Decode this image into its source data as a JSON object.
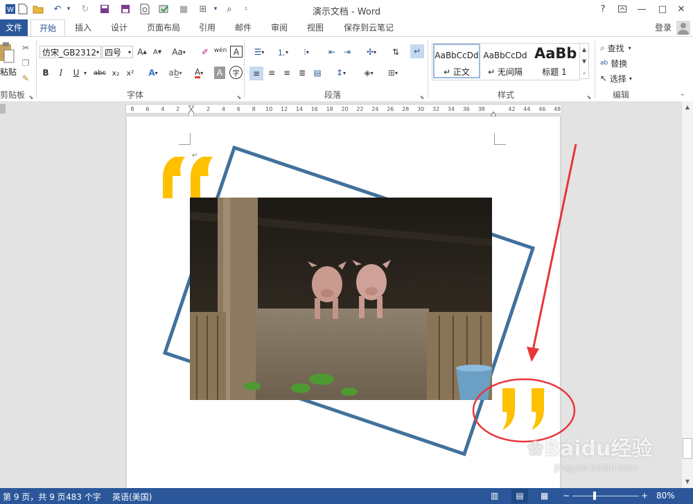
{
  "window": {
    "title": "演示文档 - Word",
    "help": "?",
    "minimize": "—",
    "maximize": "□",
    "close": "✕"
  },
  "tabs": [
    {
      "label": "文件"
    },
    {
      "label": "开始"
    },
    {
      "label": "插入"
    },
    {
      "label": "设计"
    },
    {
      "label": "页面布局"
    },
    {
      "label": "引用"
    },
    {
      "label": "邮件"
    },
    {
      "label": "审阅"
    },
    {
      "label": "视图"
    },
    {
      "label": "保存到云笔记"
    }
  ],
  "login": "登录",
  "ribbon": {
    "clipboard": {
      "paste_label": "粘贴",
      "group_label": "剪贴板"
    },
    "font": {
      "font_name": "仿宋_GB2312",
      "font_size": "四号",
      "group_label": "字体",
      "grow": "A",
      "shrink": "A",
      "change_case": "Aa",
      "bold": "B",
      "italic": "I",
      "underline": "U",
      "strike": "abc",
      "subscript": "x₂",
      "superscript": "x²",
      "phonetic": "wén",
      "border_char": "A",
      "circle_char": "字"
    },
    "paragraph": {
      "group_label": "段落"
    },
    "styles": {
      "group_label": "样式",
      "items": [
        {
          "preview": "AaBbCcDd",
          "name": "↵ 正文"
        },
        {
          "preview": "AaBbCcDd",
          "name": "↵ 无间隔"
        },
        {
          "preview": "AaBb",
          "name": "标题 1"
        }
      ]
    },
    "editing": {
      "group_label": "编辑",
      "find": "查找",
      "replace": "替换",
      "select": "选择"
    }
  },
  "ruler": {
    "ticks": [
      "8",
      "6",
      "4",
      "2",
      "",
      "2",
      "4",
      "6",
      "8",
      "10",
      "12",
      "14",
      "16",
      "18",
      "20",
      "22",
      "24",
      "26",
      "28",
      "30",
      "32",
      "34",
      "36",
      "38",
      "",
      "42",
      "44",
      "46",
      "48"
    ]
  },
  "document": {
    "image_alt": "两只小猪趴在围栏上"
  },
  "watermark": {
    "text": "Baidu经验",
    "url": "jingyan.baidu.com"
  },
  "status": {
    "page": "第 9 页，共 9 页",
    "words": "483 个字",
    "language": "英语(美国)",
    "zoom": "80%",
    "zoom_minus": "−",
    "zoom_plus": "+"
  },
  "colors": {
    "accent": "#2b579a",
    "quote": "#ffc000",
    "frame": "#41719c",
    "annotation": "#e8353b"
  }
}
